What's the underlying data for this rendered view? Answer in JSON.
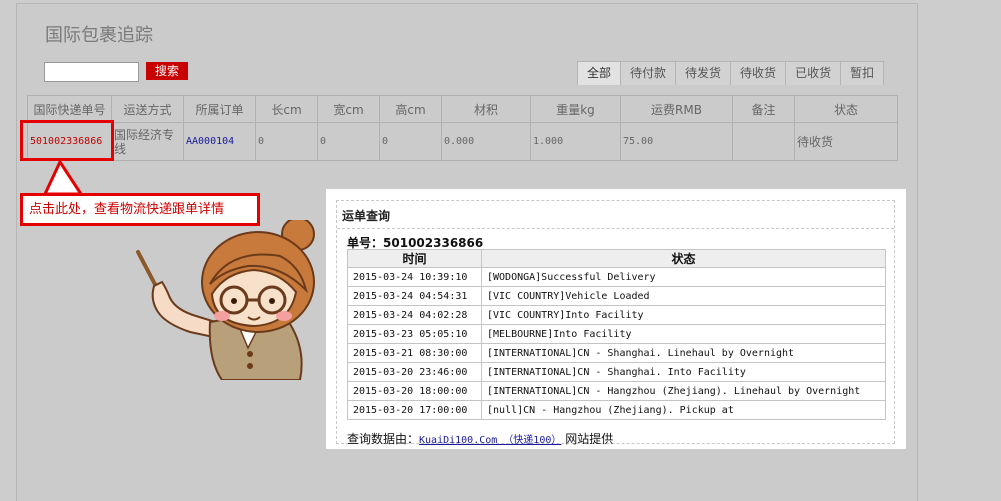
{
  "page": {
    "title": "国际包裹追踪"
  },
  "search": {
    "value": "",
    "placeholder": "",
    "button_label": "搜索"
  },
  "tabs": [
    {
      "label": "全部",
      "active": true
    },
    {
      "label": "待付款",
      "active": false
    },
    {
      "label": "待发货",
      "active": false
    },
    {
      "label": "待收货",
      "active": false
    },
    {
      "label": "已收货",
      "active": false
    },
    {
      "label": "暂扣",
      "active": false
    }
  ],
  "orders_table": {
    "headers": [
      "国际快递单号",
      "运送方式",
      "所属订单",
      "长cm",
      "宽cm",
      "高cm",
      "材积",
      "重量kg",
      "运费RMB",
      "备注",
      "状态"
    ],
    "rows": [
      [
        "501002336866",
        "国际经济专线",
        "AA000104",
        "0",
        "0",
        "0",
        "0.000",
        "1.000",
        "75.00",
        "",
        "待收货"
      ]
    ]
  },
  "callout": {
    "text": "点击此处，查看物流快递跟单详情"
  },
  "tracking_panel": {
    "title": "运单查询",
    "number_label": "单号：",
    "number": "501002336866",
    "headers": [
      "时间",
      "状态"
    ],
    "rows": [
      [
        "2015-03-24 10:39:10",
        "[WODONGA]Successful Delivery"
      ],
      [
        "2015-03-24 04:54:31",
        "[VIC COUNTRY]Vehicle Loaded"
      ],
      [
        "2015-03-24 04:02:28",
        "[VIC COUNTRY]Into Facility"
      ],
      [
        "2015-03-23 05:05:10",
        "[MELBOURNE]Into Facility"
      ],
      [
        "2015-03-21 08:30:00",
        "[INTERNATIONAL]CN - Shanghai. Linehaul by Overnight"
      ],
      [
        "2015-03-20 23:46:00",
        "[INTERNATIONAL]CN - Shanghai. Into Facility"
      ],
      [
        "2015-03-20 18:00:00",
        "[INTERNATIONAL]CN - Hangzhou (Zhejiang). Linehaul by Overnight"
      ],
      [
        "2015-03-20 17:00:00",
        "[null]CN - Hangzhou (Zhejiang). Pickup at"
      ]
    ],
    "source_prefix": "查询数据由：",
    "source_link": "KuaiDi100.Com （快递100）",
    "source_suffix": "网站提供"
  },
  "colors": {
    "accent": "#c80000",
    "background": "#cdcdcd",
    "link": "#1a1aa0"
  },
  "icons": {
    "mascot": "cartoon-girl-pointing-illustration"
  }
}
